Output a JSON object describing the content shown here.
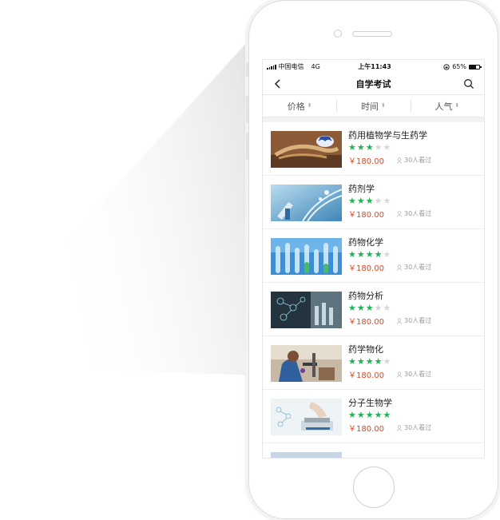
{
  "status_bar": {
    "carrier": "中国电信",
    "network": "4G",
    "time": "上午11:43",
    "battery": "65%",
    "battery_level": 0.65
  },
  "nav": {
    "title": "自学考试",
    "back_icon": "chevron-left-icon",
    "search_icon": "search-icon"
  },
  "filters": [
    {
      "label": "价格",
      "icon": "sort-arrows-icon"
    },
    {
      "label": "时间",
      "icon": "sort-arrows-icon"
    },
    {
      "label": "人气",
      "icon": "sort-arrows-icon"
    }
  ],
  "courses": [
    {
      "title": "药用植物学与生药学",
      "rating": 3,
      "max_rating": 5,
      "price": "￥180.00",
      "views": "30人看过",
      "thumb": "herbal-medicine-image"
    },
    {
      "title": "药剂学",
      "rating": 3,
      "max_rating": 5,
      "price": "￥180.00",
      "views": "30人看过",
      "thumb": "dna-lab-image"
    },
    {
      "title": "药物化学",
      "rating": 4,
      "max_rating": 5,
      "price": "￥180.00",
      "views": "30人看过",
      "thumb": "test-tubes-image"
    },
    {
      "title": "药物分析",
      "rating": 3,
      "max_rating": 5,
      "price": "￥180.00",
      "views": "30人看过",
      "thumb": "molecule-analysis-image"
    },
    {
      "title": "药学物化",
      "rating": 4,
      "max_rating": 5,
      "price": "￥180.00",
      "views": "30人看过",
      "thumb": "scientist-microscope-image"
    },
    {
      "title": "分子生物学",
      "rating": 5,
      "max_rating": 5,
      "price": "￥180.00",
      "views": "30人看过",
      "thumb": "molecular-lab-image"
    }
  ],
  "colors": {
    "star_on": "#1db354",
    "star_off": "#d7d7d7",
    "price": "#e8431b"
  }
}
